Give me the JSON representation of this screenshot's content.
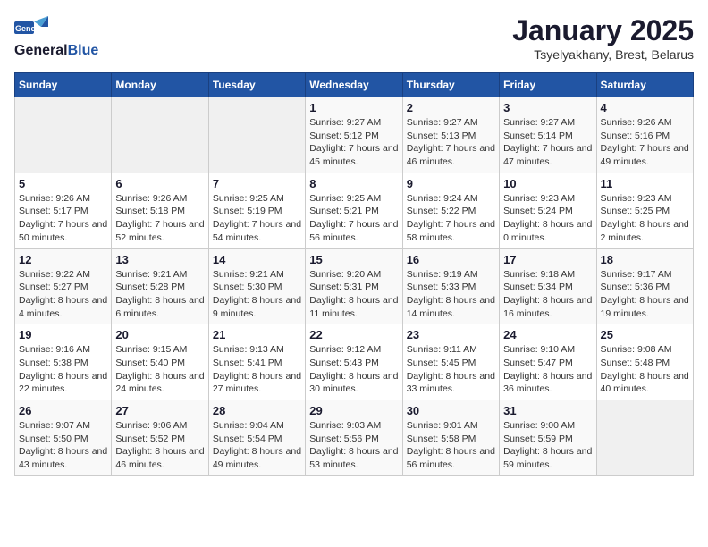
{
  "logo": {
    "general": "General",
    "blue": "Blue"
  },
  "title": "January 2025",
  "subtitle": "Tsyelyakhany, Brest, Belarus",
  "days_of_week": [
    "Sunday",
    "Monday",
    "Tuesday",
    "Wednesday",
    "Thursday",
    "Friday",
    "Saturday"
  ],
  "weeks": [
    [
      {
        "day": "",
        "info": ""
      },
      {
        "day": "",
        "info": ""
      },
      {
        "day": "",
        "info": ""
      },
      {
        "day": "1",
        "info": "Sunrise: 9:27 AM\nSunset: 5:12 PM\nDaylight: 7 hours and 45 minutes."
      },
      {
        "day": "2",
        "info": "Sunrise: 9:27 AM\nSunset: 5:13 PM\nDaylight: 7 hours and 46 minutes."
      },
      {
        "day": "3",
        "info": "Sunrise: 9:27 AM\nSunset: 5:14 PM\nDaylight: 7 hours and 47 minutes."
      },
      {
        "day": "4",
        "info": "Sunrise: 9:26 AM\nSunset: 5:16 PM\nDaylight: 7 hours and 49 minutes."
      }
    ],
    [
      {
        "day": "5",
        "info": "Sunrise: 9:26 AM\nSunset: 5:17 PM\nDaylight: 7 hours and 50 minutes."
      },
      {
        "day": "6",
        "info": "Sunrise: 9:26 AM\nSunset: 5:18 PM\nDaylight: 7 hours and 52 minutes."
      },
      {
        "day": "7",
        "info": "Sunrise: 9:25 AM\nSunset: 5:19 PM\nDaylight: 7 hours and 54 minutes."
      },
      {
        "day": "8",
        "info": "Sunrise: 9:25 AM\nSunset: 5:21 PM\nDaylight: 7 hours and 56 minutes."
      },
      {
        "day": "9",
        "info": "Sunrise: 9:24 AM\nSunset: 5:22 PM\nDaylight: 7 hours and 58 minutes."
      },
      {
        "day": "10",
        "info": "Sunrise: 9:23 AM\nSunset: 5:24 PM\nDaylight: 8 hours and 0 minutes."
      },
      {
        "day": "11",
        "info": "Sunrise: 9:23 AM\nSunset: 5:25 PM\nDaylight: 8 hours and 2 minutes."
      }
    ],
    [
      {
        "day": "12",
        "info": "Sunrise: 9:22 AM\nSunset: 5:27 PM\nDaylight: 8 hours and 4 minutes."
      },
      {
        "day": "13",
        "info": "Sunrise: 9:21 AM\nSunset: 5:28 PM\nDaylight: 8 hours and 6 minutes."
      },
      {
        "day": "14",
        "info": "Sunrise: 9:21 AM\nSunset: 5:30 PM\nDaylight: 8 hours and 9 minutes."
      },
      {
        "day": "15",
        "info": "Sunrise: 9:20 AM\nSunset: 5:31 PM\nDaylight: 8 hours and 11 minutes."
      },
      {
        "day": "16",
        "info": "Sunrise: 9:19 AM\nSunset: 5:33 PM\nDaylight: 8 hours and 14 minutes."
      },
      {
        "day": "17",
        "info": "Sunrise: 9:18 AM\nSunset: 5:34 PM\nDaylight: 8 hours and 16 minutes."
      },
      {
        "day": "18",
        "info": "Sunrise: 9:17 AM\nSunset: 5:36 PM\nDaylight: 8 hours and 19 minutes."
      }
    ],
    [
      {
        "day": "19",
        "info": "Sunrise: 9:16 AM\nSunset: 5:38 PM\nDaylight: 8 hours and 22 minutes."
      },
      {
        "day": "20",
        "info": "Sunrise: 9:15 AM\nSunset: 5:40 PM\nDaylight: 8 hours and 24 minutes."
      },
      {
        "day": "21",
        "info": "Sunrise: 9:13 AM\nSunset: 5:41 PM\nDaylight: 8 hours and 27 minutes."
      },
      {
        "day": "22",
        "info": "Sunrise: 9:12 AM\nSunset: 5:43 PM\nDaylight: 8 hours and 30 minutes."
      },
      {
        "day": "23",
        "info": "Sunrise: 9:11 AM\nSunset: 5:45 PM\nDaylight: 8 hours and 33 minutes."
      },
      {
        "day": "24",
        "info": "Sunrise: 9:10 AM\nSunset: 5:47 PM\nDaylight: 8 hours and 36 minutes."
      },
      {
        "day": "25",
        "info": "Sunrise: 9:08 AM\nSunset: 5:48 PM\nDaylight: 8 hours and 40 minutes."
      }
    ],
    [
      {
        "day": "26",
        "info": "Sunrise: 9:07 AM\nSunset: 5:50 PM\nDaylight: 8 hours and 43 minutes."
      },
      {
        "day": "27",
        "info": "Sunrise: 9:06 AM\nSunset: 5:52 PM\nDaylight: 8 hours and 46 minutes."
      },
      {
        "day": "28",
        "info": "Sunrise: 9:04 AM\nSunset: 5:54 PM\nDaylight: 8 hours and 49 minutes."
      },
      {
        "day": "29",
        "info": "Sunrise: 9:03 AM\nSunset: 5:56 PM\nDaylight: 8 hours and 53 minutes."
      },
      {
        "day": "30",
        "info": "Sunrise: 9:01 AM\nSunset: 5:58 PM\nDaylight: 8 hours and 56 minutes."
      },
      {
        "day": "31",
        "info": "Sunrise: 9:00 AM\nSunset: 5:59 PM\nDaylight: 8 hours and 59 minutes."
      },
      {
        "day": "",
        "info": ""
      }
    ]
  ]
}
